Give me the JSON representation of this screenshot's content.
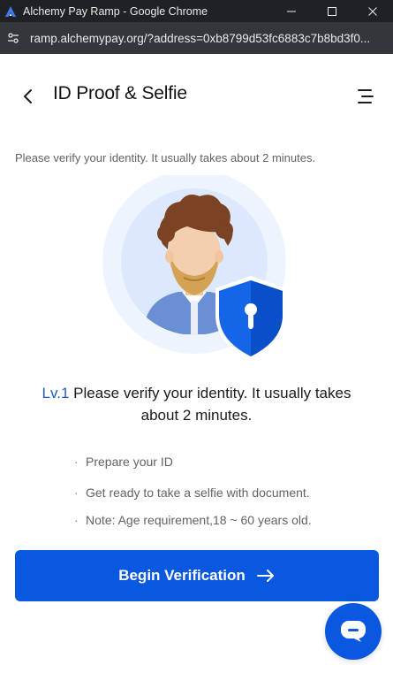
{
  "window": {
    "title": "Alchemy Pay Ramp - Google Chrome",
    "url": "ramp.alchemypay.org/?address=0xb8799d53fc6883c7b8bd3f0..."
  },
  "header": {
    "title": "ID Proof & Selfie"
  },
  "subtitle": "Please verify your identity. It usually takes about 2 minutes.",
  "level": {
    "tag": "Lv.1",
    "text": " Please verify your identity. It usually takes about 2 minutes."
  },
  "steps": [
    "Prepare your ID",
    "Get ready to take a selfie with document.",
    "Note: Age requirement,18 ~ 60 years old."
  ],
  "cta": {
    "label": "Begin Verification"
  },
  "colors": {
    "primary": "#0a57e0",
    "level_tag": "#1d5bbf",
    "titlebar": "#202124",
    "addressbar": "#35363a"
  },
  "icons": [
    "alchemy-pay-logo-icon",
    "minimize-icon",
    "maximize-icon",
    "close-icon",
    "site-info-icon",
    "back-arrow-icon",
    "menu-icon",
    "shield-icon",
    "arrow-right-icon",
    "chat-icon"
  ]
}
